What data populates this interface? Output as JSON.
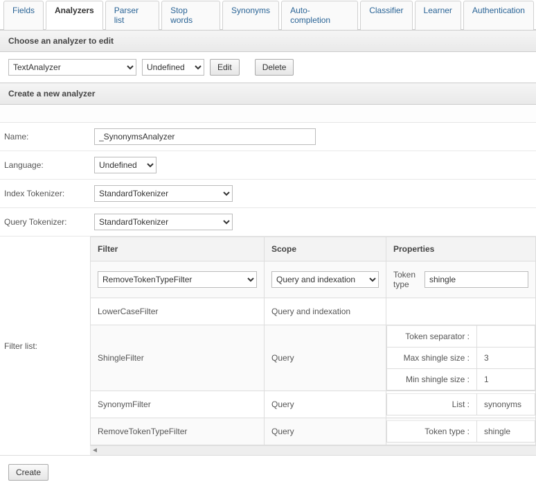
{
  "tabs": [
    "Fields",
    "Analyzers",
    "Parser list",
    "Stop words",
    "Synonyms",
    "Auto-completion",
    "Classifier",
    "Learner",
    "Authentication"
  ],
  "activeTab": "Analyzers",
  "choosePanel": {
    "title": "Choose an analyzer to edit",
    "analyzer": "TextAnalyzer",
    "language": "Undefined",
    "editBtn": "Edit",
    "deleteBtn": "Delete"
  },
  "createPanel": {
    "title": "Create a new analyzer",
    "labels": {
      "name": "Name:",
      "language": "Language:",
      "indexTok": "Index Tokenizer:",
      "queryTok": "Query Tokenizer:",
      "filterList": "Filter list:"
    },
    "name": "_SynonymsAnalyzer",
    "language": "Undefined",
    "indexTokenizer": "StandardTokenizer",
    "queryTokenizer": "StandardTokenizer",
    "filterHeaders": {
      "filter": "Filter",
      "scope": "Scope",
      "props": "Properties"
    },
    "editRow": {
      "filter": "RemoveTokenTypeFilter",
      "scope": "Query and indexation",
      "propKey": "Token type",
      "propVal": "shingle"
    },
    "rows": [
      {
        "filter": "LowerCaseFilter",
        "scope": "Query and indexation",
        "props": []
      },
      {
        "filter": "ShingleFilter",
        "scope": "Query",
        "props": [
          {
            "k": "Token separator :",
            "v": ""
          },
          {
            "k": "Max shingle size :",
            "v": "3"
          },
          {
            "k": "Min shingle size :",
            "v": "1"
          }
        ]
      },
      {
        "filter": "SynonymFilter",
        "scope": "Query",
        "props": [
          {
            "k": "List :",
            "v": "synonyms"
          }
        ]
      },
      {
        "filter": "RemoveTokenTypeFilter",
        "scope": "Query",
        "props": [
          {
            "k": "Token type :",
            "v": "shingle"
          }
        ]
      }
    ],
    "createBtn": "Create"
  }
}
